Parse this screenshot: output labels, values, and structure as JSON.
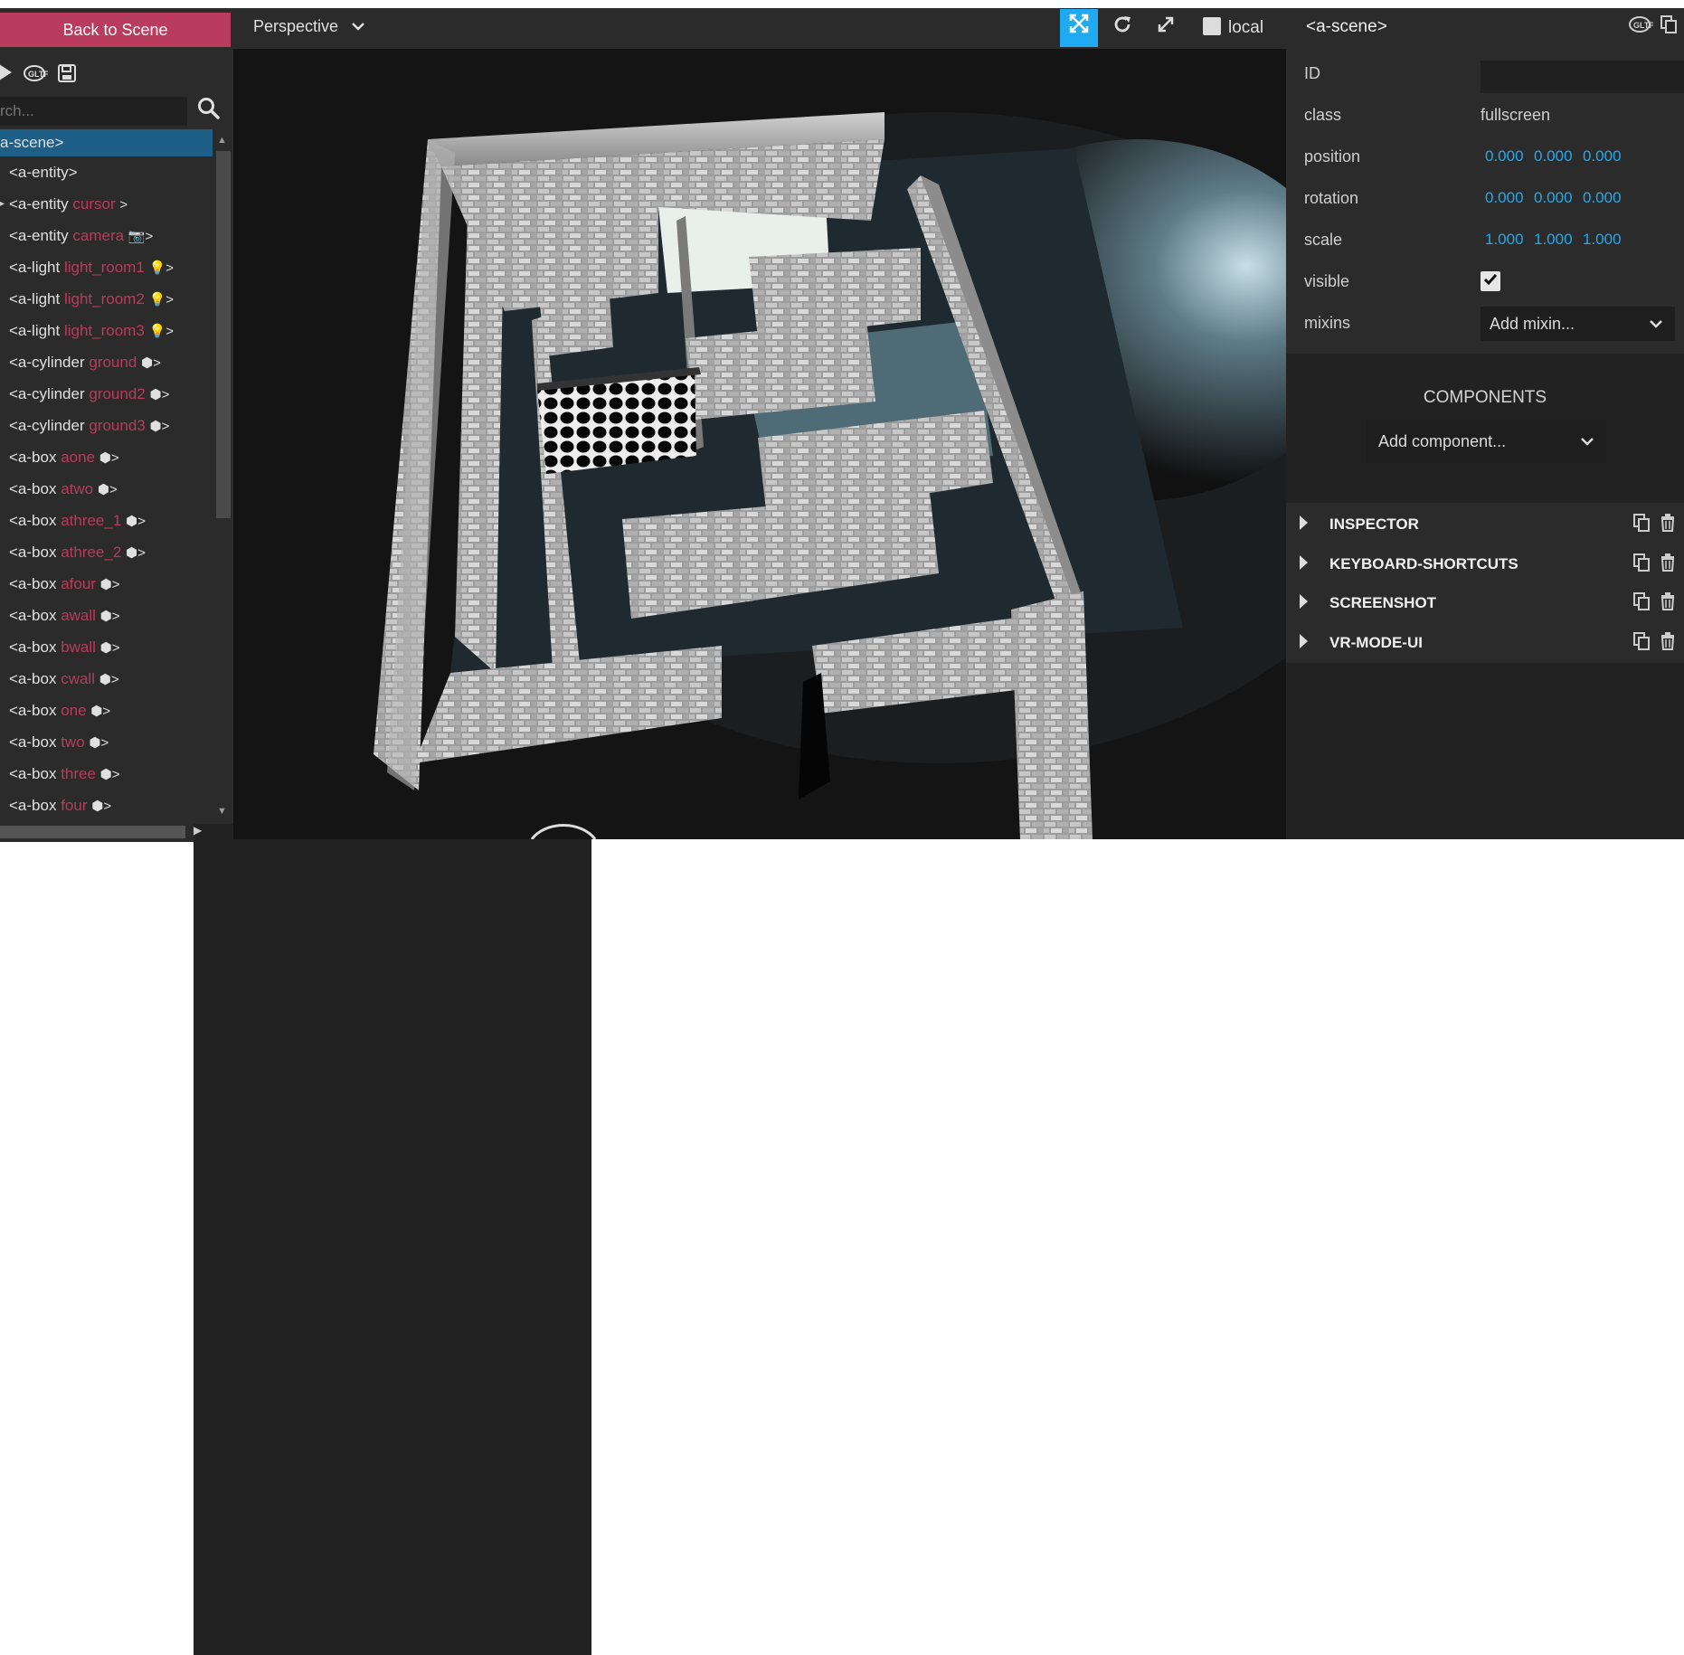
{
  "left_panel": {
    "back_button": "Back to Scene",
    "toolbar_icons": [
      "play-icon",
      "gltf-export-icon",
      "save-icon"
    ],
    "search_placeholder": "rch...",
    "tree": [
      {
        "tag": "a-scene>",
        "name": "",
        "icon": "",
        "selected": true
      },
      {
        "tag": "<a-entity>",
        "name": "",
        "icon": ""
      },
      {
        "tag": "<a-entity",
        "name": "cursor",
        "icon": ">",
        "arrow": true
      },
      {
        "tag": "<a-entity",
        "name": "camera",
        "icon": "📷>"
      },
      {
        "tag": "<a-light",
        "name": "light_room1",
        "icon": "💡>"
      },
      {
        "tag": "<a-light",
        "name": "light_room2",
        "icon": "💡>"
      },
      {
        "tag": "<a-light",
        "name": "light_room3",
        "icon": "💡>"
      },
      {
        "tag": "<a-cylinder",
        "name": "ground",
        "icon": "⬢>"
      },
      {
        "tag": "<a-cylinder",
        "name": "ground2",
        "icon": "⬢>"
      },
      {
        "tag": "<a-cylinder",
        "name": "ground3",
        "icon": "⬢>"
      },
      {
        "tag": "<a-box",
        "name": "aone",
        "icon": "⬢>"
      },
      {
        "tag": "<a-box",
        "name": "atwo",
        "icon": "⬢>"
      },
      {
        "tag": "<a-box",
        "name": "athree_1",
        "icon": "⬢>"
      },
      {
        "tag": "<a-box",
        "name": "athree_2",
        "icon": "⬢>"
      },
      {
        "tag": "<a-box",
        "name": "afour",
        "icon": "⬢>"
      },
      {
        "tag": "<a-box",
        "name": "awall",
        "icon": "⬢>"
      },
      {
        "tag": "<a-box",
        "name": "bwall",
        "icon": "⬢>"
      },
      {
        "tag": "<a-box",
        "name": "cwall",
        "icon": "⬢>"
      },
      {
        "tag": "<a-box",
        "name": "one",
        "icon": "⬢>"
      },
      {
        "tag": "<a-box",
        "name": "two",
        "icon": "⬢>"
      },
      {
        "tag": "<a-box",
        "name": "three",
        "icon": "⬢>"
      },
      {
        "tag": "<a-box",
        "name": "four",
        "icon": "⬢>"
      }
    ]
  },
  "viewport": {
    "camera_mode": "Perspective",
    "buttons": [
      "translate-icon",
      "rotate-icon",
      "scale-icon"
    ],
    "local_label": "local"
  },
  "right_panel": {
    "title": "<a-scene>",
    "header_icons": [
      "gltf-export-icon",
      "copy-icon"
    ],
    "attributes": {
      "id_label": "ID",
      "id_value": "",
      "class_label": "class",
      "class_value": "fullscreen",
      "position_label": "position",
      "position": [
        "0.000",
        "0.000",
        "0.000"
      ],
      "rotation_label": "rotation",
      "rotation": [
        "0.000",
        "0.000",
        "0.000"
      ],
      "scale_label": "scale",
      "scale": [
        "1.000",
        "1.000",
        "1.000"
      ],
      "visible_label": "visible",
      "visible": true,
      "mixins_label": "mixins",
      "mixins_placeholder": "Add mixin..."
    },
    "components_title": "COMPONENTS",
    "add_component": "Add component...",
    "components": [
      "INSPECTOR",
      "KEYBOARD-SHORTCUTS",
      "SCREENSHOT",
      "VR-MODE-UI"
    ]
  },
  "colors": {
    "accent_red": "#b93b5d",
    "accent_blue": "#1faaf2",
    "selection": "#1d5f86",
    "panel_bg": "#2b2b2b"
  }
}
